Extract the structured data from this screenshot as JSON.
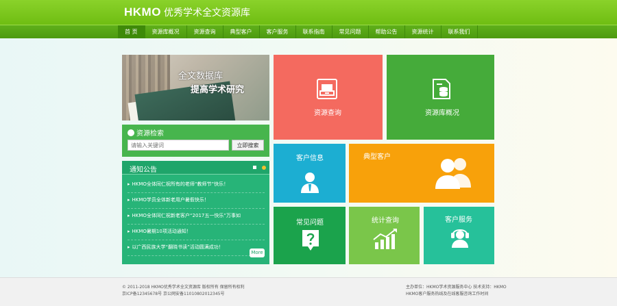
{
  "header": {
    "logo": "HKMO",
    "subtitle": "优秀学术全文资源库"
  },
  "nav": {
    "items": [
      "首 页",
      "资源库概况",
      "资源查询",
      "典型客户",
      "客户服务",
      "联系指南",
      "常见问题",
      "帮助公告",
      "资源统计",
      "联系我们"
    ],
    "active_index": 0
  },
  "banner": {
    "line1": "全文数据库",
    "line2": "提高学术研究"
  },
  "search": {
    "title": "资源检索",
    "placeholder": "请输入关键词",
    "button": "立即搜索"
  },
  "notice": {
    "title": "通知公告",
    "items": [
      "HKMO全体同仁祝所有的老师“教师节”快乐！",
      "HKMO学员全体新老用户暑假快乐！",
      "HKMO全体同仁祝新老客户“2017五一快乐”万事如",
      "HKMO暑期10项活动通知！",
      "以广西民族大学“翻晓书读”活动圆满成功！"
    ],
    "more": "More"
  },
  "tiles": {
    "search_label": "资源查询",
    "overview_label": "资源库概况",
    "info_label": "客户信息",
    "typical_label": "典型客户",
    "faq_label": "常见问题",
    "stats_label": "统计查询",
    "service_label": "客户服务"
  },
  "icons": {
    "search": "archive-box-icon",
    "overview": "database-document-icon",
    "info": "user-tie-icon",
    "typical": "users-group-icon",
    "faq": "question-doc-icon",
    "stats": "growth-chart-icon",
    "service": "headset-support-icon"
  },
  "colors": {
    "header": "#7cc61e",
    "search_tile": "#f46a5f",
    "overview_tile": "#45ab3a",
    "info_tile": "#1caed2",
    "typical_tile": "#f8a10a",
    "faq_tile": "#1ba34c",
    "stats_tile": "#7ac64a",
    "service_tile": "#26c19a",
    "notice_bg": "#27b478"
  },
  "footer": {
    "left_line1": "© 2011-2018 HKMO优秀学术全文资源库 版权所有 保留所有权利",
    "left_line2": "京ICP备12345678号 京公网安备11010802012345号",
    "right_line1": "主办单位：HKMO学术资源服务中心 技术支持：HKMO",
    "right_line2": "HKMO客户服务热线及在线客服咨询工作时间"
  }
}
